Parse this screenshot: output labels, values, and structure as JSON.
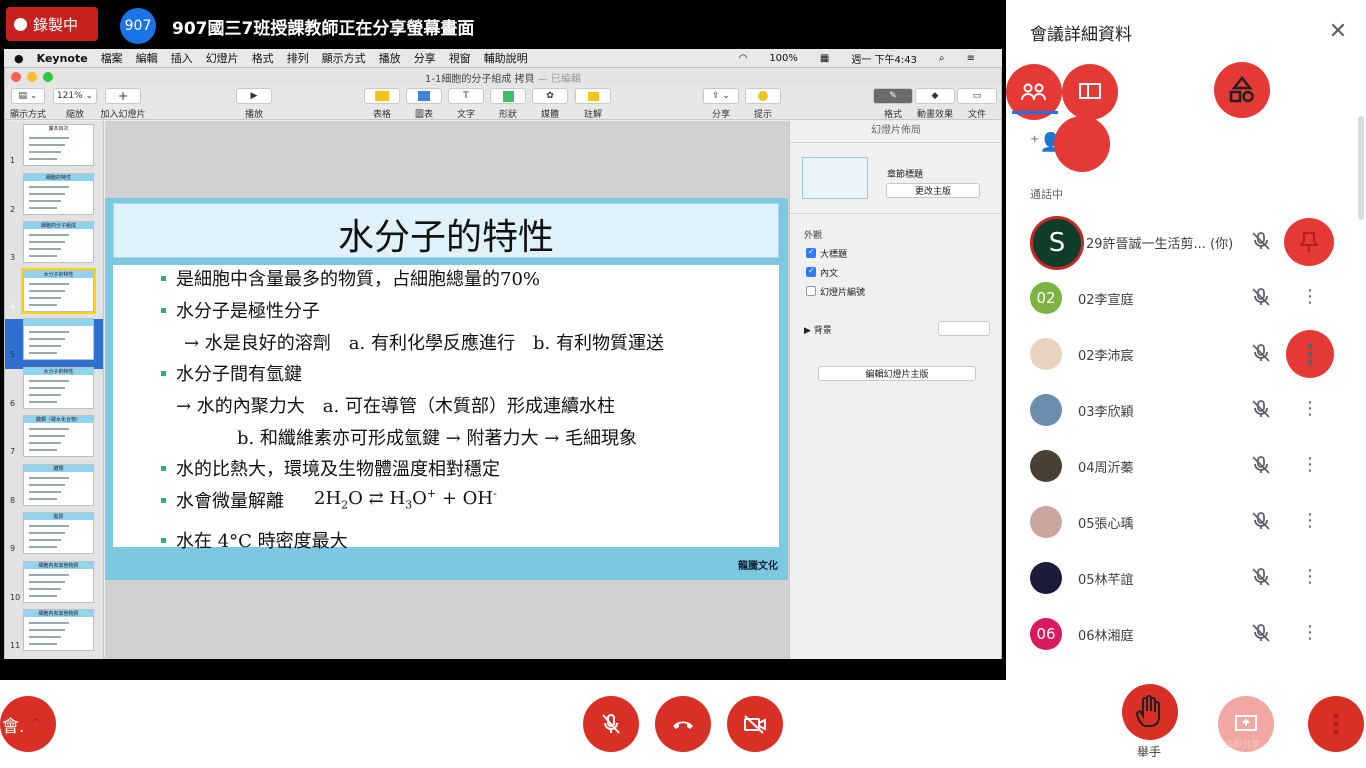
{
  "recording": {
    "label": "錄製中"
  },
  "presenter": {
    "avatar": "907",
    "title": "907國三7班授課教師正在分享螢幕畫面"
  },
  "mac_menu": {
    "apple": "",
    "app": "Keynote",
    "items": [
      "檔案",
      "編輯",
      "插入",
      "幻燈片",
      "格式",
      "排列",
      "顯示方式",
      "播放",
      "分享",
      "視窗",
      "輔助說明"
    ],
    "battery": "100%",
    "clock": "週一 下午4:43"
  },
  "keynote": {
    "window_title": "1-1細胞的分子組成 拷貝",
    "edited": "— 已編輯",
    "toolbar": {
      "view_label": "顯示方式",
      "zoom_value": "121%",
      "zoom_label": "縮放",
      "add_slide_label": "加入幻燈片",
      "play_label": "播放",
      "table_label": "表格",
      "chart_label": "圖表",
      "text_label": "文字",
      "shape_label": "形狀",
      "media_label": "媒體",
      "comment_label": "註解",
      "share_label": "分享",
      "tips_label": "提示",
      "format_label": "格式",
      "animate_label": "動畫效果",
      "document_label": "文件"
    },
    "navigator": {
      "slide_numbers": [
        "1",
        "2",
        "3",
        "4",
        "5",
        "6",
        "7",
        "8",
        "9",
        "10",
        "11"
      ],
      "thumb_titles": [
        "課本目次",
        "細胞的特性",
        "細胞的分子組成",
        "水分子的特性",
        "",
        "水分子的特性",
        "醣類（碳水化合物）",
        "醣類",
        "脂質",
        "細胞內有其他物質",
        "細胞內有其他物質"
      ]
    },
    "slide": {
      "title": "水分子的特性",
      "lines": [
        "是細胞中含量最多的物質，占細胞總量的70%",
        "水分子是極性分子",
        "→ 水是良好的溶劑　a. 有利化學反應進行　b. 有利物質運送",
        "水分子間有氫鍵",
        "→ 水的內聚力大　a. 可在導管（木質部）形成連續水柱",
        "b. 和纖維素亦可形成氫鍵 → 附著力大 → 毛細現象",
        "水的比熱大，環境及生物體溫度相對穩定",
        "水會微量解離",
        "水在 4°C 時密度最大"
      ],
      "equation_left": "2H",
      "equation_sub": "2",
      "equation_o": "O ⇄ H",
      "equation_sub2": "3",
      "equation_o2": "O",
      "equation_sup": "+",
      "equation_plus": " + OH",
      "equation_sup2": "-",
      "footer": "龍騰文化"
    },
    "inspector": {
      "header": "幻燈片佈局",
      "layout_name": "章節標題",
      "change_master": "更改主版",
      "appearance": "外觀",
      "title_check": "大標題",
      "body_check": "內文",
      "number_check": "幻燈片編號",
      "background": "背景",
      "edit_master": "編輯幻燈片主版"
    }
  },
  "panel": {
    "title": "會議詳細資料",
    "close": "✕",
    "in_call_label": "通話中",
    "participants": [
      {
        "avatar": "S",
        "name": "29許晉誠一生活剪... (你)",
        "color": "#0f3d2a"
      },
      {
        "avatar": "02",
        "name": "02李宣庭",
        "color": "#7cb342"
      },
      {
        "avatar": "",
        "name": "02李沛宸",
        "color": "#e8d2c0"
      },
      {
        "avatar": "",
        "name": "03李欣穎",
        "color": "#6a8cad"
      },
      {
        "avatar": "",
        "name": "04周沂蓁",
        "color": "#4a3f35"
      },
      {
        "avatar": "",
        "name": "05張心瑀",
        "color": "#c9a7a0"
      },
      {
        "avatar": "",
        "name": "05林芊誼",
        "color": "#1b1b3a"
      },
      {
        "avatar": "06",
        "name": "06林湘庭",
        "color": "#d81b60"
      }
    ]
  },
  "bottom": {
    "meeting_code": "會.",
    "raise_hand": "舉手",
    "present_label": "立即分享"
  },
  "colors": {
    "accent": "#1a73e8",
    "danger": "#d93025",
    "recording": "#c5221f"
  }
}
